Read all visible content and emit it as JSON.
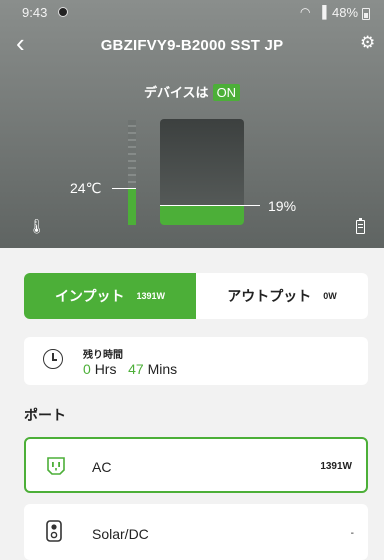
{
  "statusbar": {
    "time": "9:43",
    "battery": "48%"
  },
  "header": {
    "title": "GBZIFVY9-B2000 SST JP"
  },
  "device_status": {
    "label": "デバイスは",
    "state": "ON"
  },
  "temperature": {
    "label": "24℃",
    "level_fraction": 0.34
  },
  "battery": {
    "percent_label": "19%",
    "level_fraction": 0.19
  },
  "tabs": [
    {
      "label": "インプット",
      "value": "1391W",
      "active": true
    },
    {
      "label": "アウトプット",
      "value": "0W",
      "active": false
    }
  ],
  "remaining": {
    "title": "残り時間",
    "hours": "0",
    "hours_unit": "Hrs",
    "minutes": "47",
    "minutes_unit": "Mins"
  },
  "ports": {
    "title": "ポート",
    "items": [
      {
        "name": "AC",
        "value": "1391W",
        "icon": "ac-outlet-icon"
      },
      {
        "name": "Solar/DC",
        "value": "-",
        "icon": "solar-dc-icon"
      }
    ]
  },
  "colors": {
    "accent": "#4caf38",
    "hero_top": "#8a8e8c",
    "hero_bottom": "#5f6462"
  }
}
